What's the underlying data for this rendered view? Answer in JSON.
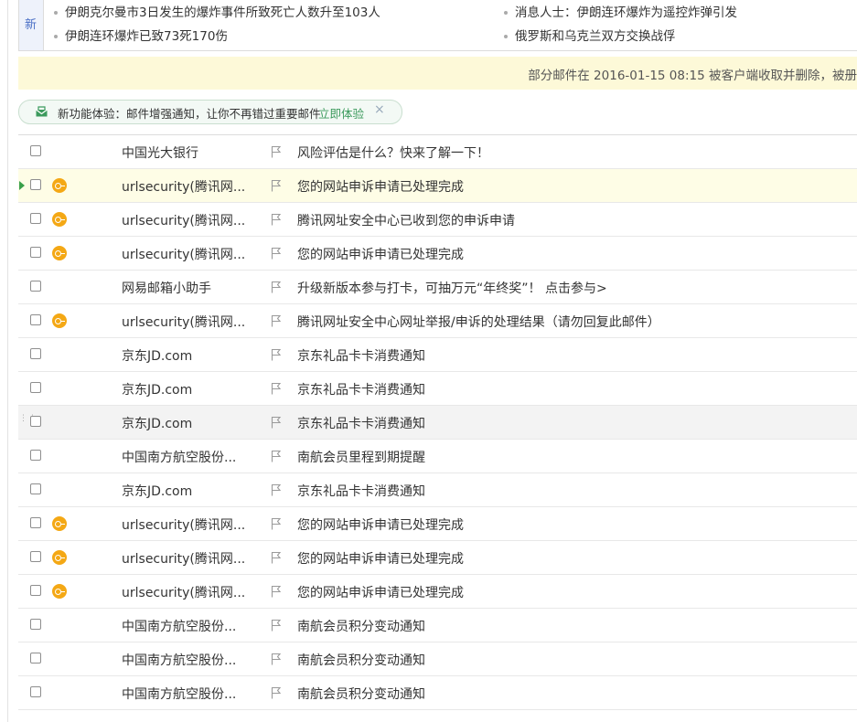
{
  "news": {
    "tag_label": "新",
    "items": [
      "伊朗克尔曼市3日发生的爆炸事件所致死亡人数升至103人",
      "消息人士：伊朗连环爆炸为遥控炸弹引发",
      "伊朗连环爆炸已致73死170伤",
      "俄罗斯和乌克兰双方交换战俘"
    ]
  },
  "notice": {
    "text": "部分邮件在 2016-01-15 08:15 被客户端收取并删除，被册"
  },
  "feature": {
    "text": "新功能体验：邮件增强通知，让你不再错过重要邮件",
    "link": "立即体验",
    "close": "×"
  },
  "colors": {
    "key_icon": "#f4a815",
    "notice_bg": "#fdf9d8",
    "link_green": "#3c9a5d",
    "highlight_row": "#fefde6"
  },
  "mails": [
    {
      "from": "中国光大银行",
      "subject": "风险评估是什么？快来了解一下！",
      "icon": ""
    },
    {
      "from": "urlsecurity(腾讯网...",
      "subject": "您的网站申诉申请已处理完成",
      "icon": "key-icon",
      "state": "current"
    },
    {
      "from": "urlsecurity(腾讯网...",
      "subject": "腾讯网址安全中心已收到您的申诉申请",
      "icon": "key-icon"
    },
    {
      "from": "urlsecurity(腾讯网...",
      "subject": "您的网站申诉申请已处理完成",
      "icon": "key-icon"
    },
    {
      "from": "网易邮箱小助手",
      "subject": "升级新版本参与打卡，可抽万元“年终奖”！ 点击参与>",
      "icon": ""
    },
    {
      "from": "urlsecurity(腾讯网...",
      "subject": "腾讯网址安全中心网址举报/申诉的处理结果（请勿回复此邮件）",
      "icon": "key-icon"
    },
    {
      "from": "京东JD.com",
      "subject": "京东礼品卡卡消费通知",
      "icon": ""
    },
    {
      "from": "京东JD.com",
      "subject": "京东礼品卡卡消费通知",
      "icon": ""
    },
    {
      "from": "京东JD.com",
      "subject": "京东礼品卡卡消费通知",
      "icon": "",
      "state": "hover"
    },
    {
      "from": "中国南方航空股份...",
      "subject": "南航会员里程到期提醒",
      "icon": ""
    },
    {
      "from": "京东JD.com",
      "subject": "京东礼品卡卡消费通知",
      "icon": ""
    },
    {
      "from": "urlsecurity(腾讯网...",
      "subject": "您的网站申诉申请已处理完成",
      "icon": "key-icon"
    },
    {
      "from": "urlsecurity(腾讯网...",
      "subject": "您的网站申诉申请已处理完成",
      "icon": "key-icon"
    },
    {
      "from": "urlsecurity(腾讯网...",
      "subject": "您的网站申诉申请已处理完成",
      "icon": "key-icon"
    },
    {
      "from": "中国南方航空股份...",
      "subject": "南航会员积分变动通知",
      "icon": ""
    },
    {
      "from": "中国南方航空股份...",
      "subject": "南航会员积分变动通知",
      "icon": ""
    },
    {
      "from": "中国南方航空股份...",
      "subject": "南航会员积分变动通知",
      "icon": ""
    }
  ]
}
